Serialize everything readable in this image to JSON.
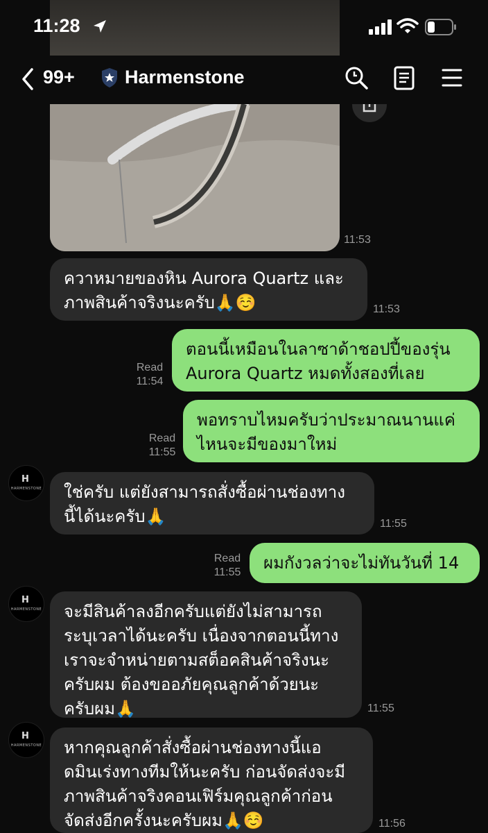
{
  "status_bar": {
    "time": "11:28"
  },
  "header": {
    "back_count": "99+",
    "chat_name": "Harmenstone"
  },
  "avatar_text": {
    "mark": "H",
    "word": "HARMENSTONE"
  },
  "messages": [
    {
      "time": "11:53"
    },
    {
      "line1": "ควาหมายของหิน Aurora Quartz และ",
      "line2": "ภาพสินค้าจริงนะครับ",
      "emoji": "🙏☺️",
      "time": "11:53"
    },
    {
      "line1": "ตอนนี้เหมือนในลาซาด้าชอปปี้ของรุ่น",
      "line2": "Aurora Quartz หมดทั้งสองที่เลย",
      "read": "Read",
      "time": "11:54"
    },
    {
      "line1": "พอทราบไหมครับว่าประมาณนานแค่",
      "line2": "ไหนจะมีของมาใหม่",
      "read": "Read",
      "time": "11:55"
    },
    {
      "line1": "ใช่ครับ แต่ยังสามารถสั่งซื้อผ่านช่องทาง",
      "line2": "นี้ได้นะครับ",
      "emoji": "🙏",
      "time": "11:55"
    },
    {
      "line1": "ผมกังวลว่าจะไม่ทันวันที่ 14",
      "read": "Read",
      "time": "11:55"
    },
    {
      "line1": "จะมีสินค้าลงอีกครับแต่ยังไม่สามารถ",
      "line2": "ระบุเวลาได้นะครับ เนื่องจากตอนนี้ทาง",
      "line3": "เราจะจำหน่ายตามสต็อคสินค้าจริงนะ",
      "line4": "ครับผม  ต้องขออภัยคุณลูกค้าด้วยนะ",
      "line5": "ครับผม",
      "emoji": "🙏",
      "time": "11:55"
    },
    {
      "line1": "หากคุณลูกค้าสั่งซื้อผ่านช่องทางนี้แอ",
      "line2": "ดมินเร่งทางทีมให้นะครับ ก่อนจัดส่งจะมี",
      "line3": "ภาพสินค้าจริงคอนเฟิร์มคุณลูกค้าก่อน",
      "line4": "จัดส่งอีกครั้งนะครับผม",
      "emoji": "🙏☺️",
      "time": "11:56"
    }
  ]
}
